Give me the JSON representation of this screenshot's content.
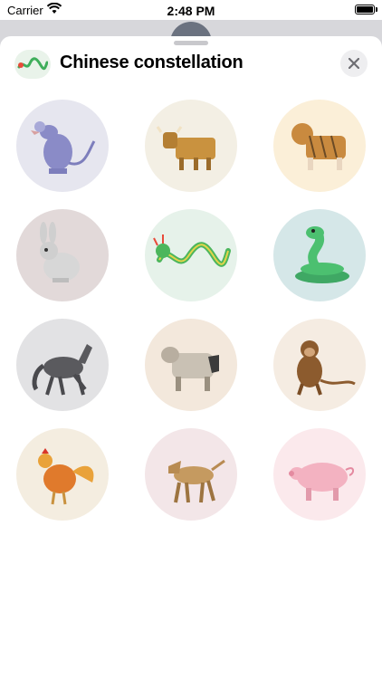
{
  "status_bar": {
    "carrier": "Carrier",
    "time": "2:48 PM"
  },
  "sheet": {
    "title": "Chinese constellation",
    "header_icon": "dragon-icon",
    "close_icon": "close-icon"
  },
  "stickers": [
    {
      "name": "rat",
      "bg": "#e6e6ef"
    },
    {
      "name": "ox",
      "bg": "#f3efe4"
    },
    {
      "name": "tiger",
      "bg": "#fbefd8"
    },
    {
      "name": "rabbit",
      "bg": "#e2d9d9"
    },
    {
      "name": "dragon",
      "bg": "#e6f2ea"
    },
    {
      "name": "snake",
      "bg": "#d5e7e8"
    },
    {
      "name": "horse",
      "bg": "#e2e2e4"
    },
    {
      "name": "goat",
      "bg": "#f3e8dc"
    },
    {
      "name": "monkey",
      "bg": "#f5ece2"
    },
    {
      "name": "rooster",
      "bg": "#f4ede0"
    },
    {
      "name": "dog",
      "bg": "#f3e6e8"
    },
    {
      "name": "pig",
      "bg": "#fbe9ec"
    }
  ]
}
